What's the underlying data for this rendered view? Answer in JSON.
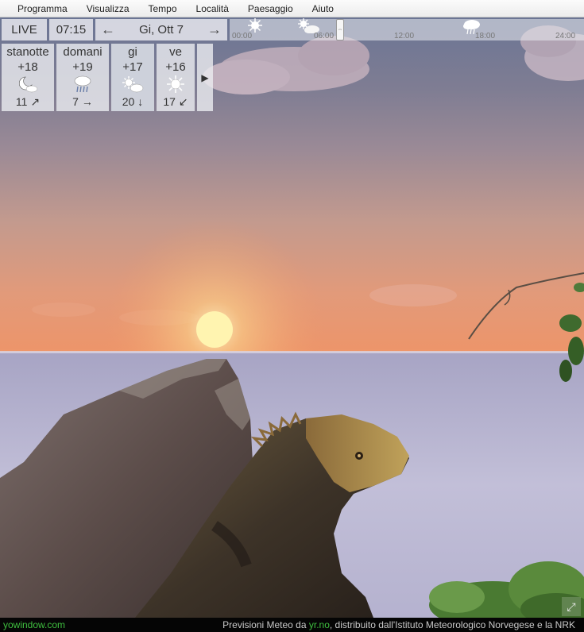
{
  "menu": [
    "Programma",
    "Visualizza",
    "Tempo",
    "Località",
    "Paesaggio",
    "Aiuto"
  ],
  "controls": {
    "live_label": "LIVE",
    "time": "07:15",
    "prev_arrow": "←",
    "date": "Gi, Ott 7",
    "next_arrow": "→"
  },
  "timeline": {
    "labels": [
      "00:00",
      "06:00",
      "12:00",
      "18:00",
      "24:00"
    ],
    "icons": [
      "sun-icon",
      "partly-cloudy-icon",
      "cloud-rain-icon"
    ],
    "handle_glyph": "⇔"
  },
  "forecast": [
    {
      "name": "stanotte",
      "temp": "+18",
      "icon": "moon-cloud-icon",
      "wind": "11 ↗"
    },
    {
      "name": "domani",
      "temp": "+19",
      "icon": "cloud-rain-icon",
      "wind": "7 →"
    },
    {
      "name": "gi",
      "temp": "+17",
      "icon": "partly-cloudy-icon",
      "wind": "20 ↓"
    },
    {
      "name": "ve",
      "temp": "+16",
      "icon": "sun-icon",
      "wind": "17 ↙"
    }
  ],
  "forecast_more": "▶",
  "footer": {
    "brand": "yowindow.com",
    "credit_prefix": "Previsioni Meteo da ",
    "credit_link": "yr.no",
    "credit_suffix": ", distribuito dall'Istituto Meteorologico Norvegese e la NRK"
  },
  "fullscreen_glyph": "⤢",
  "colors": {
    "link_green": "#3fbf3f",
    "panel_bg": "#ebecf0"
  }
}
